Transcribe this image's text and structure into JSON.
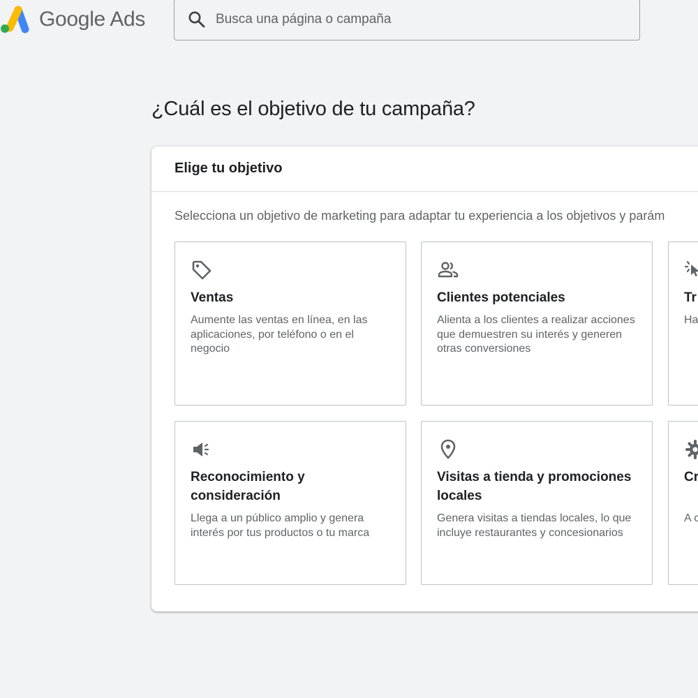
{
  "header": {
    "logo_text": "Google Ads",
    "search_placeholder": "Busca una página o campaña"
  },
  "page": {
    "title": "¿Cuál es el objetivo de tu campaña?"
  },
  "panel": {
    "title": "Elige tu objetivo",
    "description": "Selecciona un objetivo de marketing para adaptar tu experiencia a los objetivos y parám"
  },
  "cards": [
    {
      "icon": "tag-icon",
      "title": "Ventas",
      "description": "Aumente las ventas en línea, en las aplicaciones, por teléfono o en el negocio"
    },
    {
      "icon": "people-icon",
      "title": "Clientes potenciales",
      "description": "Alienta a los clientes a realizar acciones que demuestren su interés y generen otras conversiones"
    },
    {
      "icon": "cursor-click-icon",
      "title": "Tr",
      "description": "Ha vis"
    },
    {
      "icon": "megaphone-icon",
      "title": "Reconocimiento y consideración",
      "description": "Llega a un público amplio y genera interés por tus productos o tu marca"
    },
    {
      "icon": "location-pin-icon",
      "title": "Visitas a tienda y promociones locales",
      "description": "Genera visitas a tiendas locales, lo que incluye restaurantes y concesionarios"
    },
    {
      "icon": "gear-icon",
      "title": "Cr or",
      "description": "A c ca"
    }
  ],
  "colors": {
    "background": "#f1f3f4",
    "card_border": "#bdc1c6",
    "text_primary": "#202124",
    "text_secondary": "#5f6368",
    "icon": "#5f6368",
    "logo_blue": "#4285f4",
    "logo_yellow": "#fbbc04",
    "logo_green": "#34a853"
  }
}
